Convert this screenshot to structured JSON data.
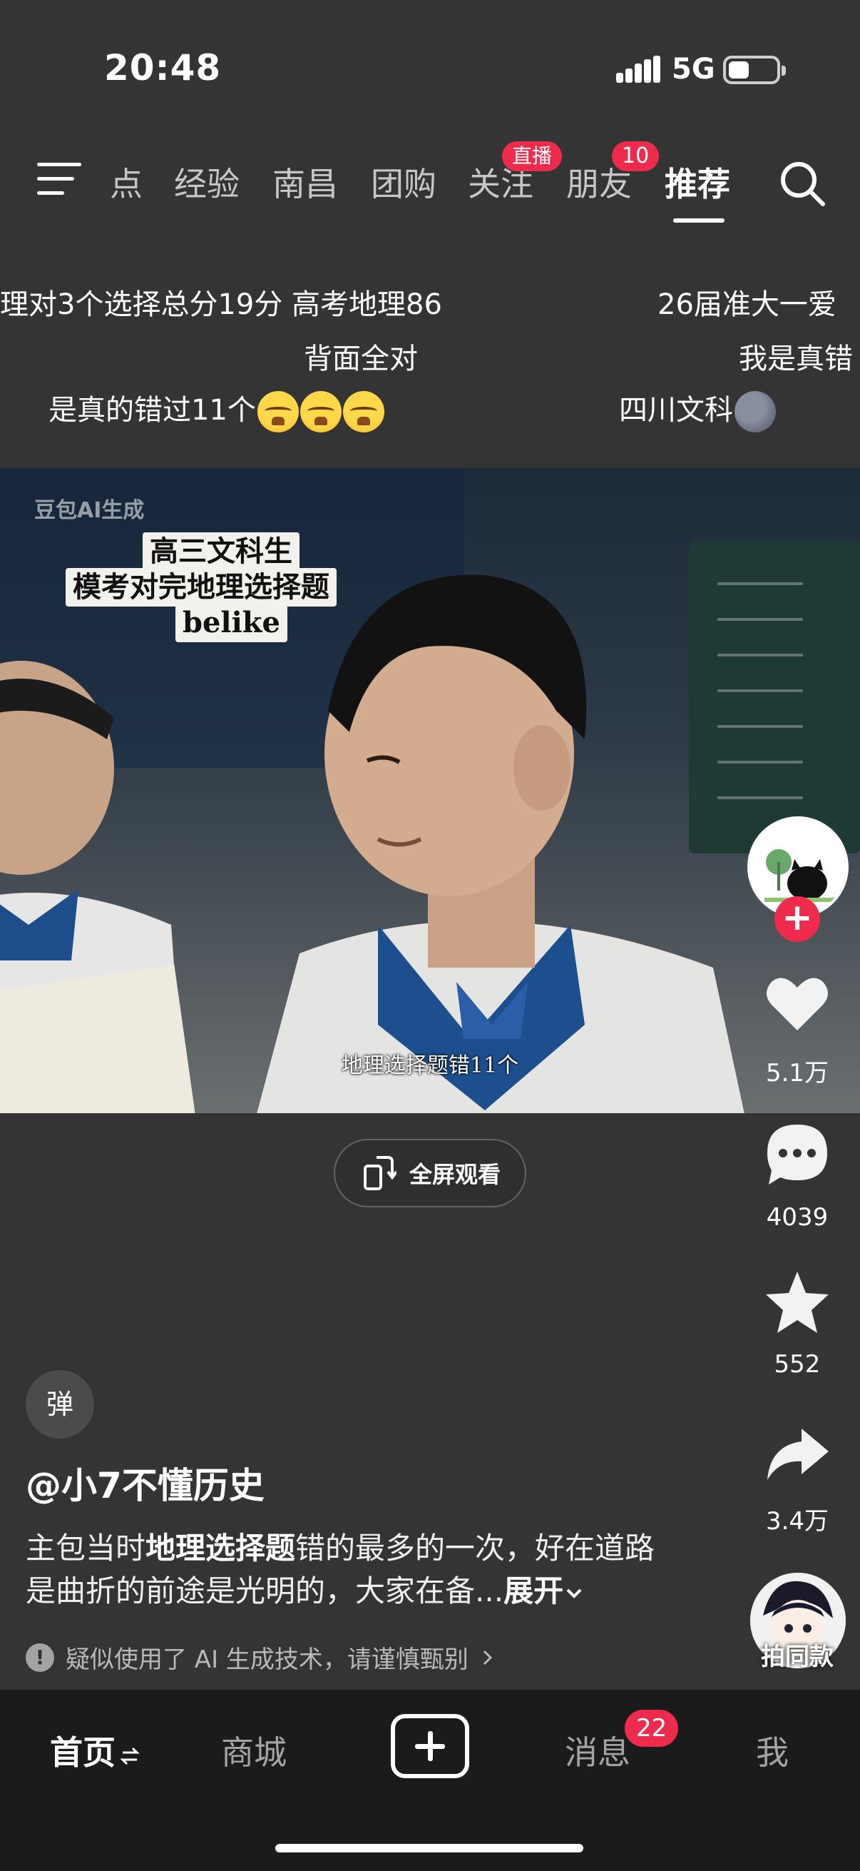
{
  "status_bar": {
    "time": "20:48",
    "network": "5G"
  },
  "top_tabs": [
    {
      "label": "点"
    },
    {
      "label": "经验"
    },
    {
      "label": "南昌"
    },
    {
      "label": "团购"
    },
    {
      "label": "关注",
      "badge": "直播"
    },
    {
      "label": "朋友",
      "badge": "10"
    },
    {
      "label": "推荐",
      "active": true
    }
  ],
  "comments": {
    "line1a": "理对3个选择总分19分 高考地理86",
    "line1b": "背面全对",
    "line1c": "是真的错过11个",
    "line2a": "26届准大一爱",
    "line2b": "我是真错",
    "line2c": "四川文科"
  },
  "video": {
    "ai_watermark": "豆包AI生成",
    "caption": [
      "高三文科生",
      "模考对完地理选择题",
      "belike"
    ],
    "subtitle": "地理选择题错11个"
  },
  "fullscreen_label": "全屏观看",
  "rail": {
    "likes": "5.1万",
    "comments": "4039",
    "favorites": "552",
    "shares": "3.4万",
    "music_label": "拍同款"
  },
  "post": {
    "danmu_toggle": "弹",
    "author": "@小7不懂历史",
    "desc_pre": "主包当时",
    "desc_bold": "地理选择题",
    "desc_mid": "错的最多的一次，好在道路是曲折的前途是光明的，大家在备...",
    "expand": "展开",
    "ai_notice": "疑似使用了 AI 生成技术，请谨慎甄别"
  },
  "bottom_nav": {
    "home": "首页",
    "mall": "商城",
    "messages": "消息",
    "messages_badge": "22",
    "me": "我"
  }
}
